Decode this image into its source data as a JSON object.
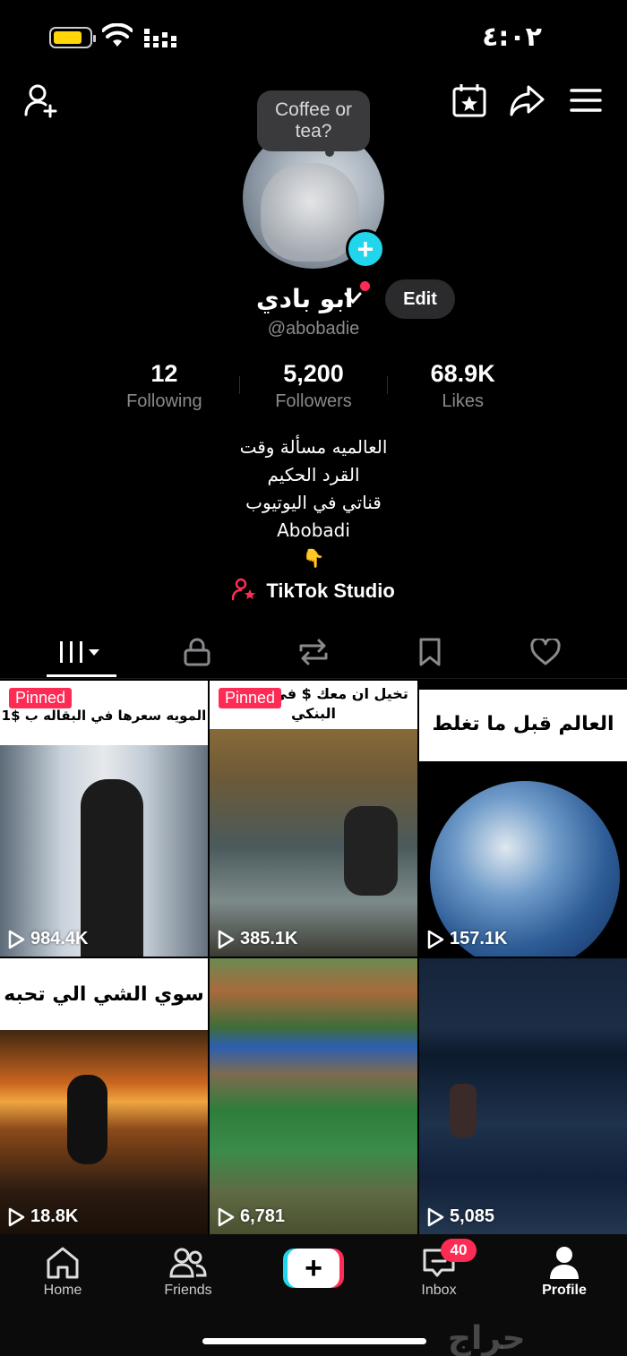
{
  "status_bar": {
    "time": "٤:٠٢"
  },
  "profile": {
    "speech_bubble": "Coffee or tea?",
    "display_name": "ابو بادي",
    "handle": "@abobadie",
    "edit_label": "Edit",
    "stats": [
      {
        "value": "12",
        "label": "Following"
      },
      {
        "value": "5,200",
        "label": "Followers"
      },
      {
        "value": "68.9K",
        "label": "Likes"
      }
    ],
    "bio_lines": [
      "العالميه مسألة وقت",
      "القرد الحكيم",
      "قناتي في اليوتيوب",
      "Abobadi",
      "👇"
    ],
    "studio_label": "TikTok Studio"
  },
  "tabs": [
    "videos-tab",
    "private-tab",
    "reposts-tab",
    "saved-tab",
    "liked-tab"
  ],
  "videos": [
    {
      "pinned": "Pinned",
      "caption": "المويه سعرها في البقاله ب $1",
      "views": "984.4K"
    },
    {
      "pinned": "Pinned",
      "caption": "تخيل ان معك $ في حسابك البنكي",
      "views": "385.1K"
    },
    {
      "pinned": "",
      "caption": "العالم قبل ما تغلط",
      "views": "157.1K"
    },
    {
      "pinned": "",
      "caption": "سوي الشي الي تحبه",
      "views": "18.8K"
    },
    {
      "pinned": "",
      "caption": "",
      "views": "6,781"
    },
    {
      "pinned": "",
      "caption": "",
      "views": "5,085"
    }
  ],
  "bottom_nav": {
    "home": "Home",
    "friends": "Friends",
    "inbox": "Inbox",
    "inbox_badge": "40",
    "profile": "Profile"
  },
  "watermark": "حراج",
  "colors": {
    "accent_red": "#fe2c55",
    "accent_cyan": "#20d5ec",
    "battery": "#ffd60a"
  }
}
